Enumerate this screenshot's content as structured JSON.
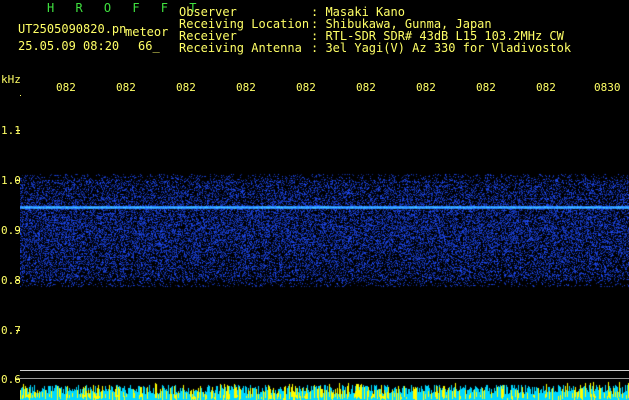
{
  "header": {
    "brand": "H R O F F T",
    "filename": "UT2505090820.pn",
    "mode": "meteor",
    "datetime": "25.05.09 08:20",
    "count": "66_",
    "fields": [
      {
        "label": "Observer",
        "value": ": Masaki Kano"
      },
      {
        "label": "Receiving Location",
        "value": ": Shibukawa, Gunma, Japan"
      },
      {
        "label": "Receiver",
        "value": ": RTL-SDR SDR# 43dB L15 103.2MHz CW"
      },
      {
        "label": "Receiving Antenna",
        "value": ": 3el Yagi(V) Az 330 for Vladivostok"
      }
    ]
  },
  "axes": {
    "y_unit": "kHz",
    "y_ticks": [
      "1.1",
      "1.0",
      "0.9",
      "0.8",
      "0.7",
      "0.6"
    ],
    "time_ticks": [
      "082",
      "082",
      "082",
      "082",
      "082",
      "082",
      "082",
      "082",
      "082",
      "0830"
    ]
  },
  "colors": {
    "text_yellow": "#ffff66",
    "text_green": "#3fe13f",
    "background": "#000000",
    "noise_blue": "#2040c0",
    "bottom_cyan": "#00d8ff"
  }
}
